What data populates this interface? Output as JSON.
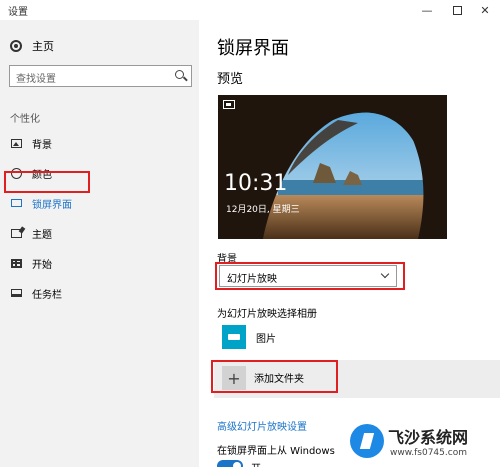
{
  "window": {
    "title": "设置",
    "controls": {
      "minimize": "—",
      "close": "✕"
    }
  },
  "sidebar": {
    "home_label": "主页",
    "search_placeholder": "查找设置",
    "section": "个性化",
    "items": [
      {
        "label": "背景",
        "icon": "picture-icon"
      },
      {
        "label": "颜色",
        "icon": "palette-icon"
      },
      {
        "label": "锁屏界面",
        "icon": "lockscreen-icon",
        "active": true
      },
      {
        "label": "主题",
        "icon": "theme-icon"
      },
      {
        "label": "开始",
        "icon": "start-icon"
      },
      {
        "label": "任务栏",
        "icon": "taskbar-icon"
      }
    ]
  },
  "main": {
    "title": "锁屏界面",
    "preview_label": "预览",
    "preview": {
      "time": "10:31",
      "date": "12月20日, 星期三"
    },
    "background_label": "背景",
    "background_value": "幻灯片放映",
    "album_label": "为幻灯片放映选择相册",
    "album_item": "图片",
    "add_folder": "添加文件夹",
    "advanced_link": "高级幻灯片放映设置",
    "lock_text": "在锁屏界面上从 Windows",
    "toggle_label": "开"
  },
  "watermark": {
    "name": "飞沙系统网",
    "url": "www.fs0745.com"
  },
  "colors": {
    "accent": "#1b74c8",
    "highlight": "#e02020",
    "album_tile": "#00a3c8"
  }
}
